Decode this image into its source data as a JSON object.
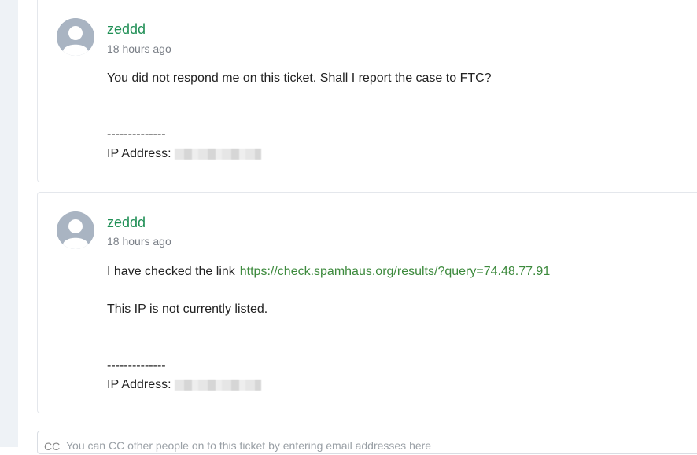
{
  "comments": [
    {
      "author": "zeddd",
      "time": "18 hours ago",
      "lines": [
        "You did not respond me on this ticket. Shall I report the case to FTC?"
      ],
      "separator": "--------------",
      "ip_label": "IP Address:"
    },
    {
      "author": "zeddd",
      "time": "18 hours ago",
      "link_prefix": "I have checked the link",
      "link_text": "https://check.spamhaus.org/results/?query=74.48.77.91",
      "lines": [
        "This IP is not currently listed."
      ],
      "separator": "--------------",
      "ip_label": "IP Address:"
    }
  ],
  "cc": {
    "label": "CC",
    "placeholder": "You can CC other people on to this ticket by entering email addresses here"
  },
  "colors": {
    "author": "#1f8f55",
    "link": "#3d8a3d",
    "avatar": "#a9b4c2"
  },
  "icons": {
    "avatar": "user-avatar-icon"
  }
}
